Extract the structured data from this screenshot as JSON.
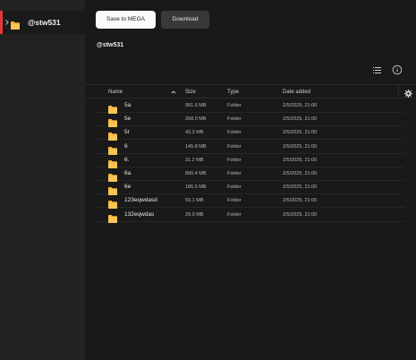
{
  "sidebar": {
    "items": [
      {
        "label": "@stw531",
        "icon": "folder-icon",
        "chevron": "chevron-right-icon"
      }
    ]
  },
  "toolbar": {
    "save_label": "Save to MEGA",
    "download_label": "Download"
  },
  "breadcrumb": {
    "title": "@stw531"
  },
  "view_controls": {
    "list_icon": "list-view-icon",
    "info_icon": "info-icon"
  },
  "table": {
    "headers": {
      "name": "Name",
      "size": "Size",
      "type": "Type",
      "date": "Date added"
    },
    "sort_icon": "chevron-up-icon",
    "settings_icon": "gear-icon",
    "rows": [
      {
        "name": "5a",
        "size": "951.6 MB",
        "type": "Folder",
        "date": "2/5/2025, 21:00"
      },
      {
        "name": "5e",
        "size": "268.0 MB",
        "type": "Folder",
        "date": "2/5/2025, 21:00"
      },
      {
        "name": "5r",
        "size": "43.3 MB",
        "type": "Folder",
        "date": "2/5/2025, 21:00"
      },
      {
        "name": "6",
        "size": "145.8 MB",
        "type": "Folder",
        "date": "2/5/2025, 21:00"
      },
      {
        "name": "6.",
        "size": "31.2 MB",
        "type": "Folder",
        "date": "2/5/2025, 21:00"
      },
      {
        "name": "6a",
        "size": "890.4 MB",
        "type": "Folder",
        "date": "2/5/2025, 21:00"
      },
      {
        "name": "6e",
        "size": "186.5 MB",
        "type": "Folder",
        "date": "2/5/2025, 21:00"
      },
      {
        "name": "123eqwdasd",
        "size": "59.1 MB",
        "type": "Folder",
        "date": "2/5/2025, 21:00"
      },
      {
        "name": "132eqwdas",
        "size": "29.9 MB",
        "type": "Folder",
        "date": "2/5/2025, 21:00"
      }
    ]
  },
  "colors": {
    "accent": "#e5363a",
    "folder": "#f5b63b",
    "background": "#191919",
    "sidebar": "#222222"
  }
}
